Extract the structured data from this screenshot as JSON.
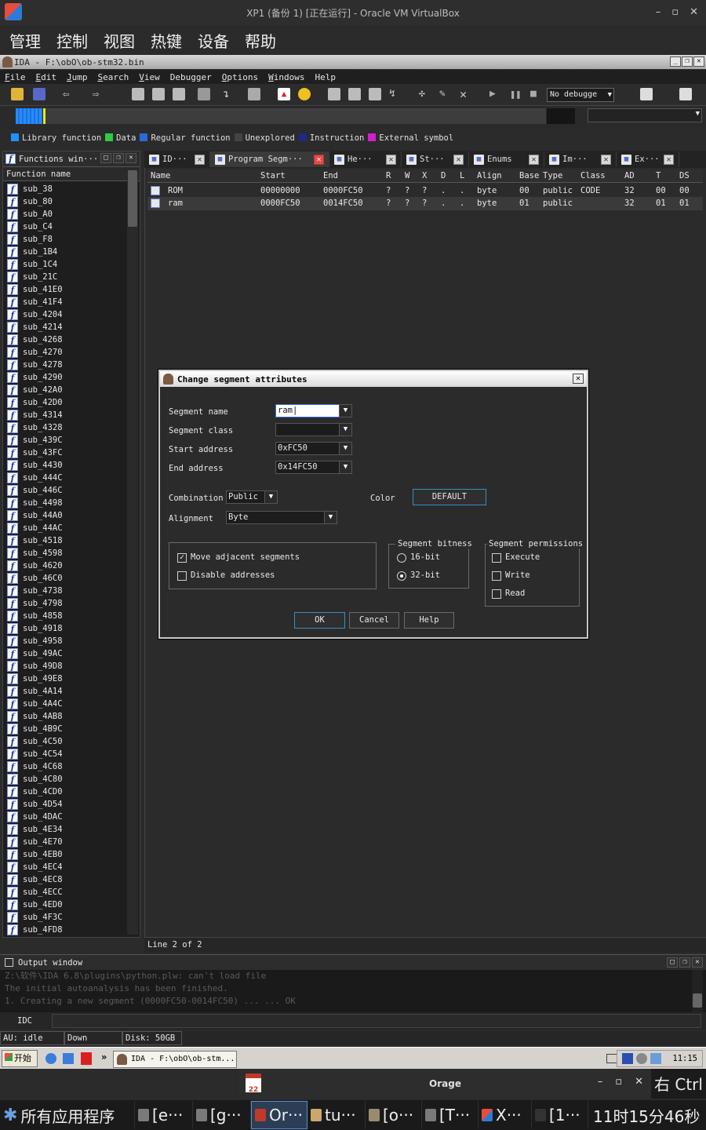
{
  "host": {
    "title": "XP1 (备份 1) [正在运行] - Oracle VM VirtualBox",
    "menu": [
      "管理",
      "控制",
      "视图",
      "热键",
      "设备",
      "帮助"
    ]
  },
  "ida": {
    "title": "IDA - F:\\obO\\ob-stm32.bin",
    "menu": [
      {
        "u": "F",
        "rest": "ile"
      },
      {
        "u": "E",
        "rest": "dit"
      },
      {
        "u": "J",
        "rest": "ump"
      },
      {
        "u": "S",
        "rest": "earch"
      },
      {
        "u": "V",
        "rest": "iew"
      },
      {
        "u": "",
        "rest": "Debugger"
      },
      {
        "u": "O",
        "rest": "ptions"
      },
      {
        "u": "W",
        "rest": "indows"
      },
      {
        "u": "",
        "rest": "Help"
      }
    ],
    "debugger_select": "No debugge",
    "legend": [
      {
        "label": "Library function",
        "color": "#1e90ff"
      },
      {
        "label": "Data",
        "color": "#2ecc40"
      },
      {
        "label": "Regular function",
        "color": "#2a6bd8"
      },
      {
        "label": "Unexplored",
        "color": "#444444"
      },
      {
        "label": "Instruction",
        "color": "#1c2a8a"
      },
      {
        "label": "External symbol",
        "color": "#d01fd0"
      }
    ]
  },
  "functions": {
    "title": "Functions win···",
    "column": "Function name",
    "items": [
      "sub_38",
      "sub_80",
      "sub_A0",
      "sub_C4",
      "sub_F8",
      "sub_1B4",
      "sub_1C4",
      "sub_21C",
      "sub_41E0",
      "sub_41F4",
      "sub_4204",
      "sub_4214",
      "sub_4268",
      "sub_4270",
      "sub_4278",
      "sub_4290",
      "sub_42A0",
      "sub_42D0",
      "sub_4314",
      "sub_4328",
      "sub_439C",
      "sub_43FC",
      "sub_4430",
      "sub_444C",
      "sub_446C",
      "sub_4498",
      "sub_44A0",
      "sub_44AC",
      "sub_4518",
      "sub_4598",
      "sub_4620",
      "sub_46C0",
      "sub_4738",
      "sub_4798",
      "sub_4858",
      "sub_4918",
      "sub_4958",
      "sub_49AC",
      "sub_49D8",
      "sub_49E8",
      "sub_4A14",
      "sub_4A4C",
      "sub_4AB8",
      "sub_4B9C",
      "sub_4C50",
      "sub_4C54",
      "sub_4C68",
      "sub_4C80",
      "sub_4CD0",
      "sub_4D54",
      "sub_4DAC",
      "sub_4E34",
      "sub_4E70",
      "sub_4EB0",
      "sub_4EC4",
      "sub_4EC8",
      "sub_4ECC",
      "sub_4ED0",
      "sub_4F3C",
      "sub_4FD8"
    ]
  },
  "tabs": [
    {
      "label": "ID···",
      "icon": "ida-view-icon",
      "active": false
    },
    {
      "label": "Program Segm···",
      "icon": "segments-icon",
      "active": true
    },
    {
      "label": "He···",
      "icon": "hex-view-icon",
      "active": false
    },
    {
      "label": "St···",
      "icon": "strings-icon",
      "active": false
    },
    {
      "label": "Enums",
      "icon": "enums-icon",
      "active": false
    },
    {
      "label": "Im···",
      "icon": "imports-icon",
      "active": false
    },
    {
      "label": "Ex···",
      "icon": "exports-icon",
      "active": false
    }
  ],
  "segments": {
    "columns": [
      "Name",
      "Start",
      "End",
      "R",
      "W",
      "X",
      "D",
      "L",
      "Align",
      "Base",
      "Type",
      "Class",
      "AD",
      "T",
      "DS"
    ],
    "rows": [
      [
        "ROM",
        "00000000",
        "0000FC50",
        "?",
        "?",
        "?",
        ".",
        ".",
        "byte",
        "00",
        "public",
        "CODE",
        "32",
        "00",
        "00"
      ],
      [
        "ram",
        "0000FC50",
        "0014FC50",
        "?",
        "?",
        "?",
        ".",
        ".",
        "byte",
        "01",
        "public",
        "",
        "32",
        "01",
        "01"
      ]
    ],
    "status": "Line 2 of 2"
  },
  "dialog": {
    "title": "Change segment attributes",
    "segment_name_label": "Segment name",
    "segment_name_value": "ram",
    "segment_class_label": "Segment class",
    "segment_class_value": "",
    "start_label": "Start address",
    "start_value": "0xFC50",
    "end_label": "End address",
    "end_value": "0x14FC50",
    "combination_label": "Combination",
    "combination_value": "Public",
    "color_label": "Color",
    "color_value": "DEFAULT",
    "alignment_label": "Alignment",
    "alignment_value": "Byte",
    "move_adjacent": "Move adjacent segments",
    "disable_addresses": "Disable addresses",
    "bitness_title": "Segment bitness",
    "bit16": "16-bit",
    "bit32": "32-bit",
    "perm_title": "Segment permissions",
    "execute": "Execute",
    "write": "Write",
    "read": "Read",
    "ok": "OK",
    "cancel": "Cancel",
    "help": "Help"
  },
  "output": {
    "title": "Output window",
    "lines": [
      "Z:\\软件\\IDA 6.8\\plugins\\python.plw: can't load file",
      "The initial autoanalysis has been finished.",
      "  1. Creating a new segment  (0000FC50-0014FC50) ... ... OK"
    ],
    "idc_label": "IDC"
  },
  "statusbar": {
    "au": "AU:  idle",
    "dir": "Down",
    "disk": "Disk: 50GB"
  },
  "xp": {
    "start": "开始",
    "task": "IDA - F:\\obO\\ob-stm...",
    "time": "11:15"
  },
  "orage": {
    "title": "Orage",
    "date": "22"
  },
  "host_key": "右 Ctrl",
  "panel": {
    "apps": "所有应用程序",
    "tasks": [
      "[e···",
      "[g···",
      "Or···",
      "tu···",
      "[o···",
      "[T···",
      "X···",
      "[1···"
    ],
    "clock": "11时15分46秒"
  }
}
